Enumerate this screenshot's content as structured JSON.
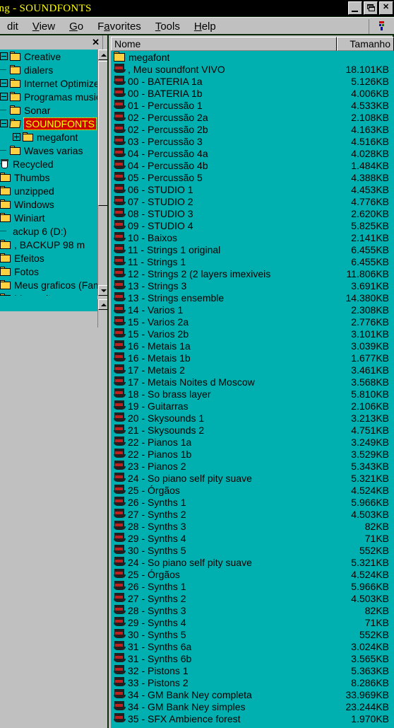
{
  "window": {
    "title": "ing - SOUNDFONTS",
    "title_color": "#ffff00",
    "titlebar_color": "#000000",
    "buttons": {
      "minimize": "minimize",
      "restore": "restore",
      "close": "✕"
    }
  },
  "menubar": {
    "items": [
      {
        "label": "dit",
        "accel": ""
      },
      {
        "label": "View",
        "accel": "V"
      },
      {
        "label": "Go",
        "accel": "G"
      },
      {
        "label": "Favorites",
        "accel": "a"
      },
      {
        "label": "Tools",
        "accel": "T"
      },
      {
        "label": "Help",
        "accel": "H"
      }
    ]
  },
  "sidebar": {
    "close_label": "✕",
    "background": "#00b0b0",
    "selection_bg": "#d00000",
    "selection_fg": "#ffff00",
    "items": [
      {
        "label": "Creative",
        "icon": "folder-icon",
        "indent": 0,
        "expander": "minus",
        "selected": false
      },
      {
        "label": "dialers",
        "icon": "folder-icon",
        "indent": 0,
        "expander": "dots",
        "selected": false
      },
      {
        "label": "Internet Optimizer",
        "icon": "folder-icon",
        "indent": 0,
        "expander": "minus",
        "selected": false
      },
      {
        "label": "Programas music",
        "icon": "folder-icon",
        "indent": 0,
        "expander": "minus",
        "selected": false
      },
      {
        "label": "Sonar",
        "icon": "folder-icon",
        "indent": 0,
        "expander": "dots",
        "selected": false
      },
      {
        "label": "SOUNDFONTS",
        "icon": "folder-open-icon",
        "indent": 0,
        "expander": "minus",
        "selected": true
      },
      {
        "label": "megafont",
        "icon": "folder-icon",
        "indent": 1,
        "expander": "plus",
        "selected": false
      },
      {
        "label": "Waves varias",
        "icon": "folder-icon",
        "indent": 0,
        "expander": "dots",
        "selected": false
      },
      {
        "label": "Recycled",
        "icon": "recycle-bin-icon",
        "indent": 0,
        "expander": "none",
        "selected": false
      },
      {
        "label": "Thumbs",
        "icon": "folder-icon",
        "indent": 0,
        "expander": "none",
        "selected": false
      },
      {
        "label": "unzipped",
        "icon": "folder-icon",
        "indent": 0,
        "expander": "none",
        "selected": false
      },
      {
        "label": "Windows",
        "icon": "folder-icon",
        "indent": 0,
        "expander": "none",
        "selected": false
      },
      {
        "label": "Winiart",
        "icon": "folder-icon",
        "indent": 0,
        "expander": "none",
        "selected": false
      },
      {
        "label": "ackup 6 (D:)",
        "icon": "drive-icon",
        "indent": 0,
        "expander": "none",
        "selected": false
      },
      {
        "label": ",     BACKUP  98    m",
        "icon": "folder-icon",
        "indent": 0,
        "expander": "none",
        "selected": false
      },
      {
        "label": "Efeitos",
        "icon": "folder-icon",
        "indent": 0,
        "expander": "none",
        "selected": false
      },
      {
        "label": "Fotos",
        "icon": "folder-icon",
        "indent": 0,
        "expander": "none",
        "selected": false
      },
      {
        "label": "Meus graficos (Famil",
        "icon": "folder-icon",
        "indent": 0,
        "expander": "none",
        "selected": false
      },
      {
        "label": "Meus sitos",
        "icon": "folder-icon",
        "indent": 0,
        "expander": "none",
        "selected": false
      }
    ]
  },
  "filelist": {
    "background": "#00b0b0",
    "columns": [
      {
        "key": "name",
        "label": "Nome"
      },
      {
        "key": "size",
        "label": "Tamanho"
      }
    ],
    "rows": [
      {
        "name": "megafont",
        "size": "",
        "icon": "folder-icon"
      },
      {
        "name": ",  Meu soundfont VIVO",
        "size": "18.101KB",
        "icon": "soundfont-icon"
      },
      {
        "name": "00 - BATERIA 1a",
        "size": "5.126KB",
        "icon": "soundfont-icon"
      },
      {
        "name": "00 - BATERIA 1b",
        "size": "4.006KB",
        "icon": "soundfont-icon"
      },
      {
        "name": "01 - Percussão 1",
        "size": "4.533KB",
        "icon": "soundfont-icon"
      },
      {
        "name": "02 - Percussão 2a",
        "size": "2.108KB",
        "icon": "soundfont-icon"
      },
      {
        "name": "02 - Percussão 2b",
        "size": "4.163KB",
        "icon": "soundfont-icon"
      },
      {
        "name": "03 - Percussão 3",
        "size": "4.516KB",
        "icon": "soundfont-icon"
      },
      {
        "name": "04 - Percussão 4a",
        "size": "4.028KB",
        "icon": "soundfont-icon"
      },
      {
        "name": "04 - Percussão 4b",
        "size": "1.484KB",
        "icon": "soundfont-icon"
      },
      {
        "name": "05 - Percussão 5",
        "size": "4.388KB",
        "icon": "soundfont-icon"
      },
      {
        "name": "06 - STUDIO 1",
        "size": "4.453KB",
        "icon": "soundfont-icon"
      },
      {
        "name": "07 - STUDIO 2",
        "size": "4.776KB",
        "icon": "soundfont-icon"
      },
      {
        "name": "08 - STUDIO 3",
        "size": "2.620KB",
        "icon": "soundfont-icon"
      },
      {
        "name": "09 - STUDIO 4",
        "size": "5.825KB",
        "icon": "soundfont-icon"
      },
      {
        "name": "10 - Baixos",
        "size": "2.141KB",
        "icon": "soundfont-icon"
      },
      {
        "name": "11 - Strings 1 original",
        "size": "6.455KB",
        "icon": "soundfont-icon"
      },
      {
        "name": "11 - Strings 1",
        "size": "6.455KB",
        "icon": "soundfont-icon"
      },
      {
        "name": "12 - Strings 2 (2 layers imexiveis",
        "size": "11.806KB",
        "icon": "soundfont-icon"
      },
      {
        "name": "13 - Strings 3",
        "size": "3.691KB",
        "icon": "soundfont-icon"
      },
      {
        "name": "13 - Strings ensemble",
        "size": "14.380KB",
        "icon": "soundfont-icon"
      },
      {
        "name": "14 - Varios 1",
        "size": "2.308KB",
        "icon": "soundfont-icon"
      },
      {
        "name": "15 - Varios 2a",
        "size": "2.776KB",
        "icon": "soundfont-icon"
      },
      {
        "name": "15 - Varios 2b",
        "size": "3.101KB",
        "icon": "soundfont-icon"
      },
      {
        "name": "16 - Metais 1a",
        "size": "3.039KB",
        "icon": "soundfont-icon"
      },
      {
        "name": "16 - Metais 1b",
        "size": "1.677KB",
        "icon": "soundfont-icon"
      },
      {
        "name": "17 - Metais 2",
        "size": "3.461KB",
        "icon": "soundfont-icon"
      },
      {
        "name": "17 - Metais Noites d Moscow",
        "size": "3.568KB",
        "icon": "soundfont-icon"
      },
      {
        "name": "18 - So brass layer",
        "size": "5.810KB",
        "icon": "soundfont-icon"
      },
      {
        "name": "19 - Guitarras",
        "size": "2.106KB",
        "icon": "soundfont-icon"
      },
      {
        "name": "20 - Skysounds 1",
        "size": "3.213KB",
        "icon": "soundfont-icon"
      },
      {
        "name": "21 - Skysounds 2",
        "size": "4.751KB",
        "icon": "soundfont-icon"
      },
      {
        "name": "22 - Pianos 1a",
        "size": "3.249KB",
        "icon": "soundfont-icon"
      },
      {
        "name": "22 - Pianos 1b",
        "size": "3.529KB",
        "icon": "soundfont-icon"
      },
      {
        "name": "23 - Pianos 2",
        "size": "5.343KB",
        "icon": "soundfont-icon"
      },
      {
        "name": "24 - So piano self pity suave",
        "size": "5.321KB",
        "icon": "soundfont-icon"
      },
      {
        "name": "25 - Órgãos",
        "size": "4.524KB",
        "icon": "soundfont-icon"
      },
      {
        "name": "26 - Synths 1",
        "size": "5.966KB",
        "icon": "soundfont-icon"
      },
      {
        "name": "27 - Synths 2",
        "size": "4.503KB",
        "icon": "soundfont-icon"
      },
      {
        "name": "28 - Synths 3",
        "size": "82KB",
        "icon": "soundfont-icon"
      },
      {
        "name": "29 - Synths 4",
        "size": "71KB",
        "icon": "soundfont-icon"
      },
      {
        "name": "30 - Synths 5",
        "size": "552KB",
        "icon": "soundfont-icon"
      },
      {
        "name": "24 - So piano self pity suave",
        "size": "5.321KB",
        "icon": "soundfont-icon"
      },
      {
        "name": "25 - Órgãos",
        "size": "4.524KB",
        "icon": "soundfont-icon"
      },
      {
        "name": "26 - Synths 1",
        "size": "5.966KB",
        "icon": "soundfont-icon"
      },
      {
        "name": "27 - Synths 2",
        "size": "4.503KB",
        "icon": "soundfont-icon"
      },
      {
        "name": "28 - Synths 3",
        "size": "82KB",
        "icon": "soundfont-icon"
      },
      {
        "name": "29 - Synths 4",
        "size": "71KB",
        "icon": "soundfont-icon"
      },
      {
        "name": "30 - Synths 5",
        "size": "552KB",
        "icon": "soundfont-icon"
      },
      {
        "name": "31 - Synths 6a",
        "size": "3.024KB",
        "icon": "soundfont-icon"
      },
      {
        "name": "31 - Synths 6b",
        "size": "3.565KB",
        "icon": "soundfont-icon"
      },
      {
        "name": "32 - Pistons 1",
        "size": "5.363KB",
        "icon": "soundfont-icon"
      },
      {
        "name": "33 - Pistons 2",
        "size": "8.286KB",
        "icon": "soundfont-icon"
      },
      {
        "name": "34 - GM Bank Ney completa",
        "size": "33.969KB",
        "icon": "soundfont-icon"
      },
      {
        "name": "34 - GM Bank Ney simples",
        "size": "23.244KB",
        "icon": "soundfont-icon"
      },
      {
        "name": "35 - SFX Ambience forest",
        "size": "1.970KB",
        "icon": "soundfont-icon"
      }
    ]
  }
}
